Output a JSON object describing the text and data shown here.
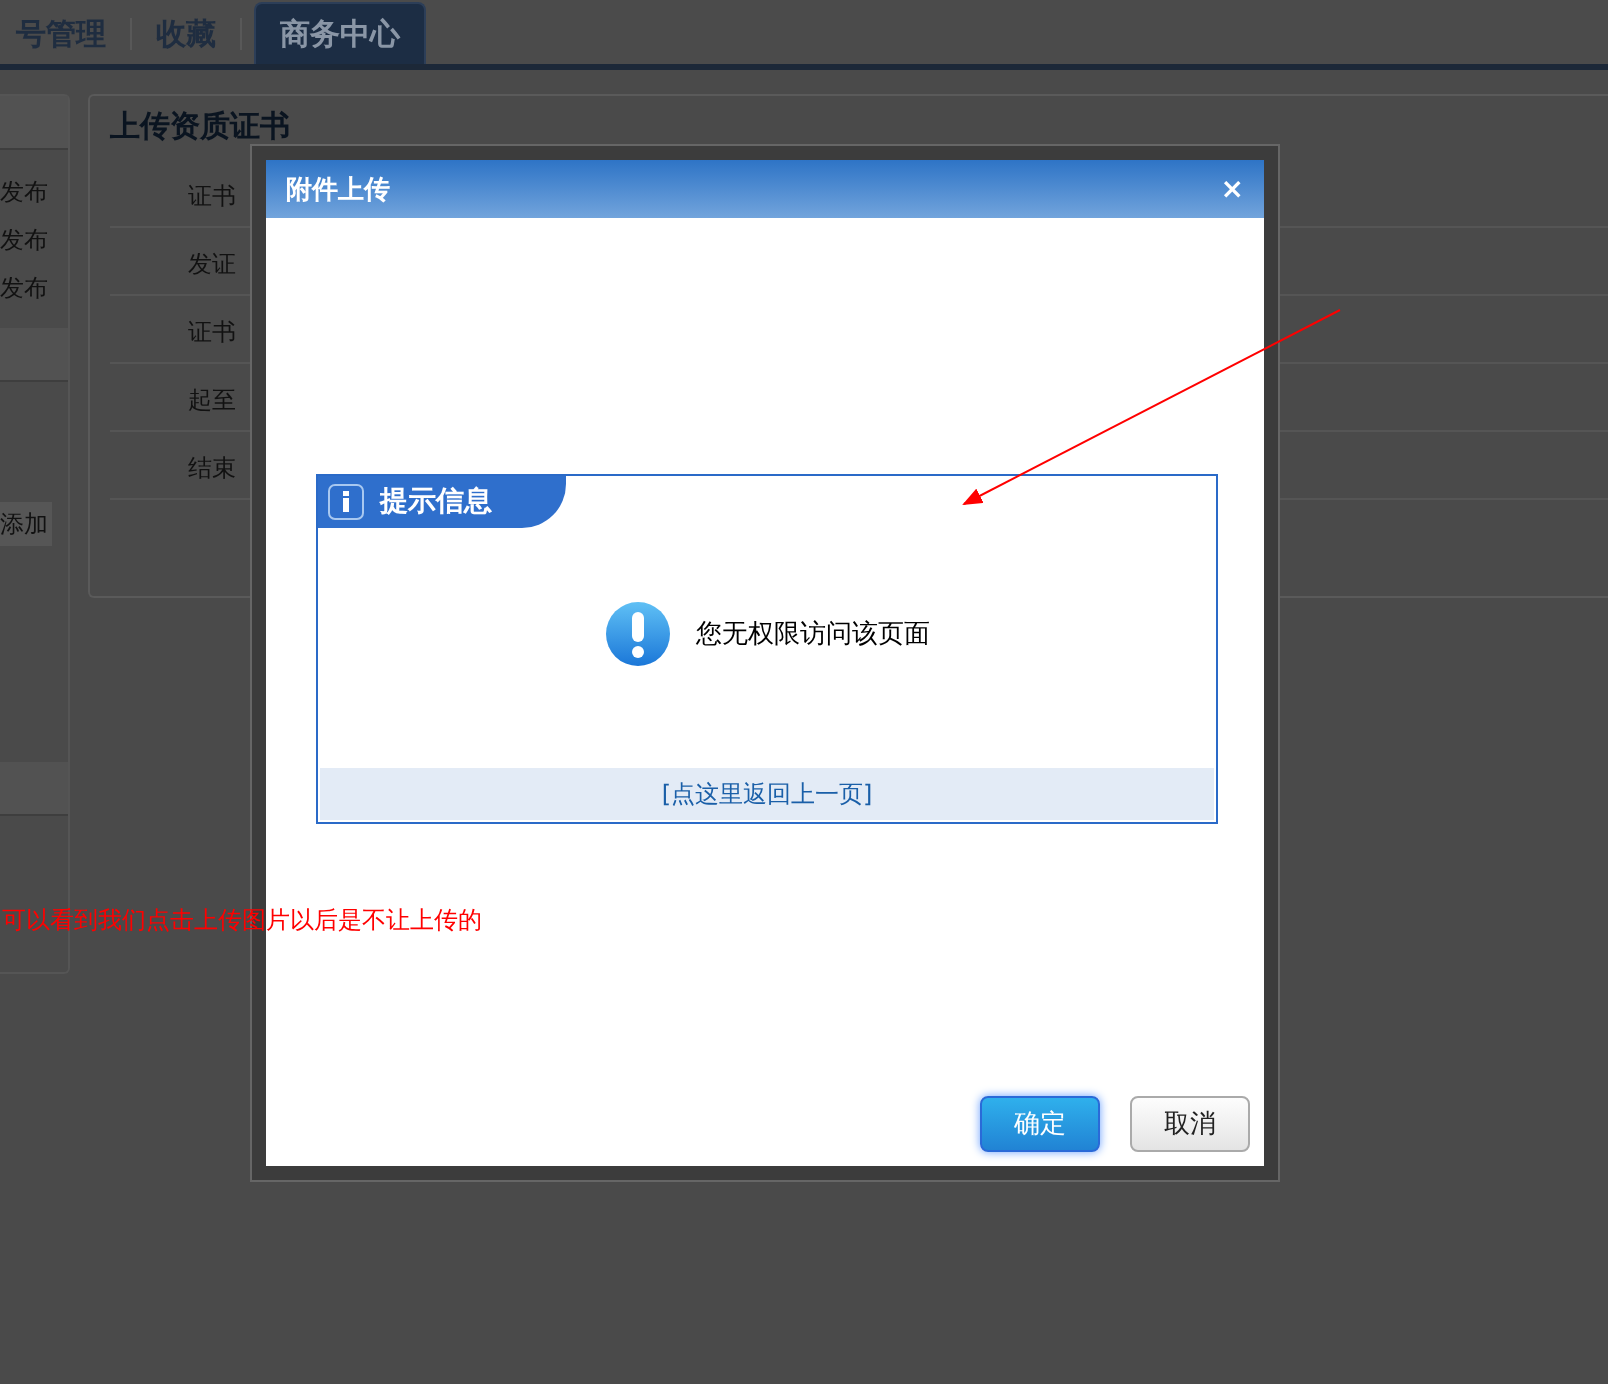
{
  "tabs": [
    {
      "label": "号管理",
      "selected": false
    },
    {
      "label": "收藏",
      "selected": false
    },
    {
      "label": "商务中心",
      "selected": true
    }
  ],
  "sidebar": {
    "items": [
      "发布",
      "发布",
      "发布"
    ],
    "add_button": "添加"
  },
  "panel": {
    "title": "上传资质证书",
    "fields": [
      "证书",
      "发证",
      "证书",
      "起至",
      "结束"
    ]
  },
  "dialog": {
    "title": "附件上传",
    "close": "×",
    "message_box": {
      "title": "提示信息",
      "message": "您无权限访问该页面",
      "link": "[点这里返回上一页]"
    },
    "buttons": [
      {
        "label": "确定",
        "kind": "primary"
      },
      {
        "label": "取消",
        "kind": "default"
      }
    ]
  },
  "annotation": {
    "text": "可以看到我们点击上传图片以后是不让上传的"
  }
}
